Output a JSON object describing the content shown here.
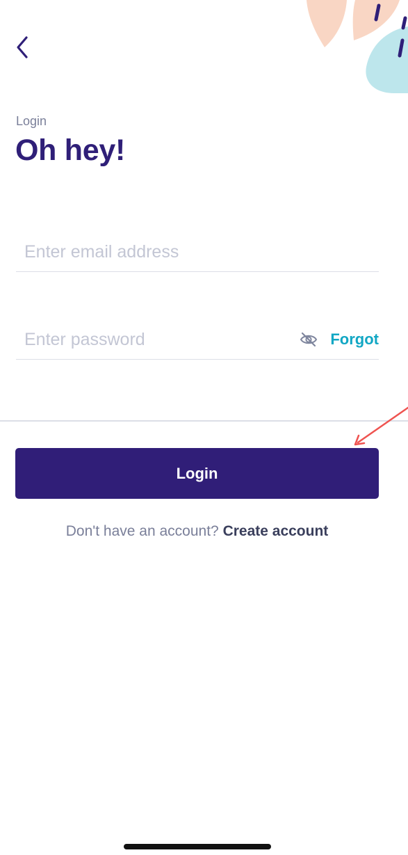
{
  "header": {
    "back_icon": "chevron-left-icon",
    "eyebrow": "Login",
    "title": "Oh hey!"
  },
  "form": {
    "email": {
      "value": "",
      "placeholder": "Enter email address"
    },
    "password": {
      "value": "",
      "placeholder": "Enter password",
      "toggle_icon": "eye-off-icon",
      "forgot_label": "Forgot"
    },
    "login_label": "Login"
  },
  "signup": {
    "prompt": "Don't have an account?",
    "link": "Create account"
  },
  "colors": {
    "brand": "#301e78",
    "accent": "#12a7c4",
    "annotation": "#ef5350"
  }
}
